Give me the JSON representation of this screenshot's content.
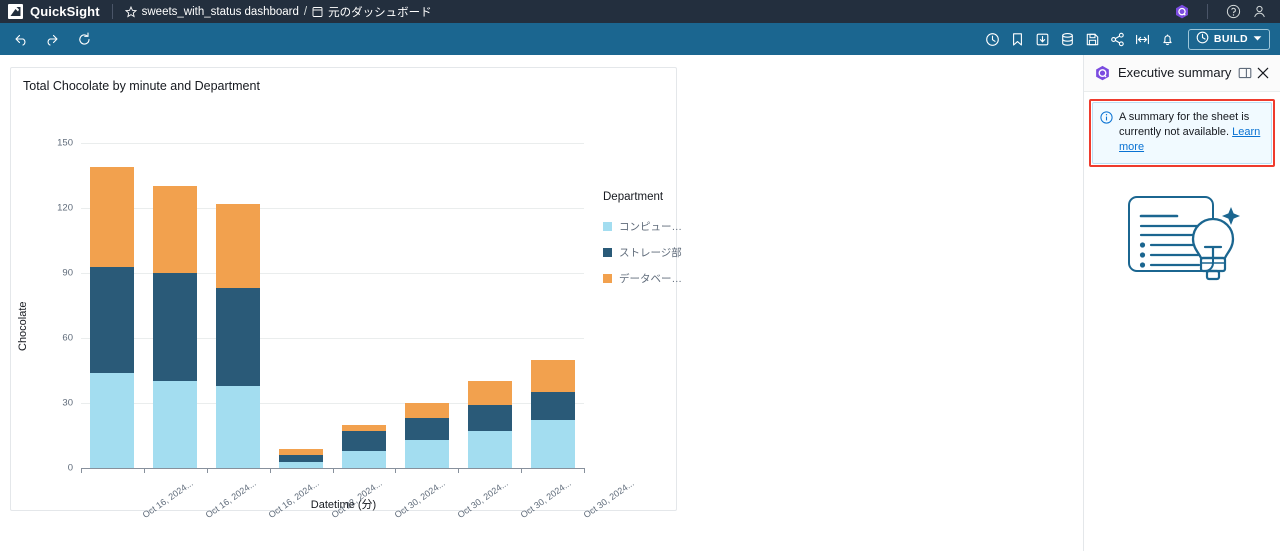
{
  "topbar": {
    "logo_icon": "quicksight-logo-icon",
    "product_name": "QuickSight",
    "star_icon": "star-outline-icon",
    "dashboard_name": "sweets_with_status dashboard",
    "separator": "/",
    "sheet_icon": "sheet-icon",
    "sheet_name": "元のダッシュボード",
    "q_icon": "amazon-q-hexagon-icon",
    "help_icon": "help-circle-icon",
    "account_icon": "user-account-icon"
  },
  "toolbar": {
    "undo_icon": "undo-icon",
    "redo_icon": "redo-icon",
    "reset_icon": "reset-icon",
    "history_icon": "clock-history-icon",
    "bookmark_icon": "bookmark-icon",
    "export_icon": "download-icon",
    "dataset_icon": "database-icon",
    "save_icon": "save-icon",
    "share_icon": "share-icon",
    "fitwidth_icon": "fit-width-icon",
    "alert_icon": "bell-icon",
    "build_icon": "build-circle-icon",
    "build_label": "BUILD",
    "build_caret_icon": "chevron-down-icon"
  },
  "visual": {
    "title": "Total Chocolate by minute and Department"
  },
  "right_panel": {
    "q_icon": "amazon-q-hexagon-icon",
    "title": "Executive summary",
    "layout_icon": "panel-layout-icon",
    "close_icon": "close-icon",
    "alert": {
      "icon": "info-circle-icon",
      "text": "A summary for the sheet is currently not available. ",
      "link_text": "Learn more"
    },
    "illustration_icon": "summary-lightbulb-illustration-icon"
  },
  "colors": {
    "topbar_bg": "#232f3e",
    "toolbar_bg": "#1b6690",
    "series_1": "#a3ddf0",
    "series_2": "#2a5a78",
    "series_3": "#f2a14e",
    "alert_border": "#ef3b2d",
    "link": "#0972d3"
  },
  "chart_data": {
    "type": "bar",
    "subtype": "stacked-vertical",
    "title": "Total Chocolate by minute and Department",
    "xlabel": "Datetime (分)",
    "ylabel": "Chocolate",
    "ylim": [
      0,
      150
    ],
    "yticks": [
      0,
      30,
      60,
      90,
      120,
      150
    ],
    "grid": true,
    "legend_title": "Department",
    "legend_position": "right",
    "categories": [
      "Oct 16, 2024...",
      "Oct 16, 2024...",
      "Oct 16, 2024...",
      "Oct 22, 2024...",
      "Oct 30, 2024...",
      "Oct 30, 2024...",
      "Oct 30, 2024...",
      "Oct 30, 2024..."
    ],
    "series": [
      {
        "name": "コンピュー…",
        "color": "#a3ddf0",
        "values": [
          44,
          40,
          38,
          3,
          8,
          13,
          17,
          22
        ]
      },
      {
        "name": "ストレージ部",
        "color": "#2a5a78",
        "values": [
          49,
          50,
          45,
          3,
          9,
          10,
          12,
          13
        ]
      },
      {
        "name": "データベー…",
        "color": "#f2a14e",
        "values": [
          46,
          40,
          39,
          3,
          3,
          7,
          11,
          15
        ]
      }
    ],
    "totals": [
      139,
      130,
      122,
      9,
      20,
      30,
      40,
      50
    ]
  }
}
